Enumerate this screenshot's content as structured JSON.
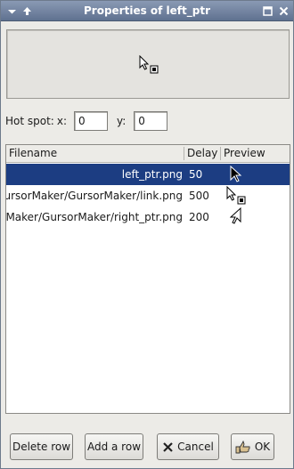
{
  "window": {
    "title": "Properties of left_ptr"
  },
  "hotspot": {
    "label": "Hot spot:",
    "x_label": "x:",
    "x_value": "0",
    "y_label": "y:",
    "y_value": "0"
  },
  "list": {
    "columns": [
      "Filename",
      "Delay",
      "Preview"
    ],
    "rows": [
      {
        "filename": "left_ptr.png",
        "delay": "50",
        "preview_icon": "arrow-cursor",
        "selected": true
      },
      {
        "filename": "GursorMaker/GursorMaker/link.png",
        "delay": "500",
        "preview_icon": "link-cursor",
        "selected": false
      },
      {
        "filename": "GursorMaker/GursorMaker/right_ptr.png",
        "delay": "200",
        "preview_icon": "right-arrow-cursor",
        "selected": false
      }
    ]
  },
  "buttons": {
    "delete_row": "Delete row",
    "add_row": "Add a row",
    "cancel": "Cancel",
    "ok": "OK"
  },
  "colors": {
    "selection": "#1c3d82",
    "titlebar": "#5f7190"
  }
}
